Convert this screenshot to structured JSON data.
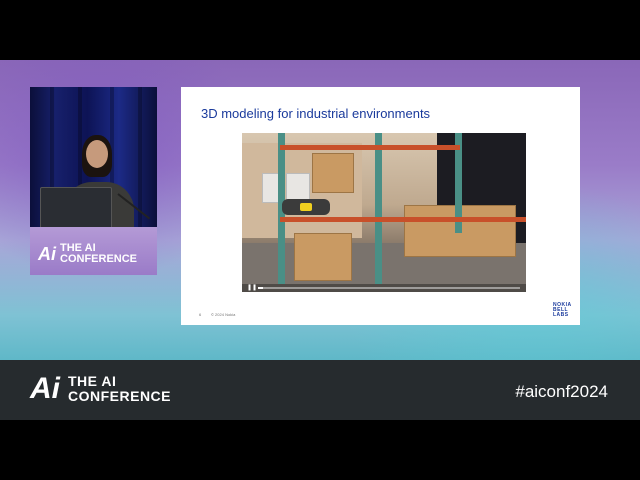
{
  "speaker_podium": {
    "logo_mark": "Ai",
    "logo_line1": "THE AI",
    "logo_line2": "CONFERENCE"
  },
  "slide": {
    "title": "3D modeling for industrial environments",
    "page_number": "6",
    "copyright": "© 2024 Nokia",
    "logo_lines": [
      "NOKIA",
      "BELL",
      "LABS"
    ],
    "video": {
      "progress": 0.02
    }
  },
  "banner": {
    "logo_mark": "Ai",
    "logo_line1": "THE AI",
    "logo_line2": "CONFERENCE",
    "hashtag": "#aiconf2024"
  },
  "colors": {
    "slide_title": "#1a3a9c",
    "banner_bg": "#262b2e",
    "gradient_top": "#8a67b8",
    "gradient_bottom": "#5fb8c8"
  }
}
